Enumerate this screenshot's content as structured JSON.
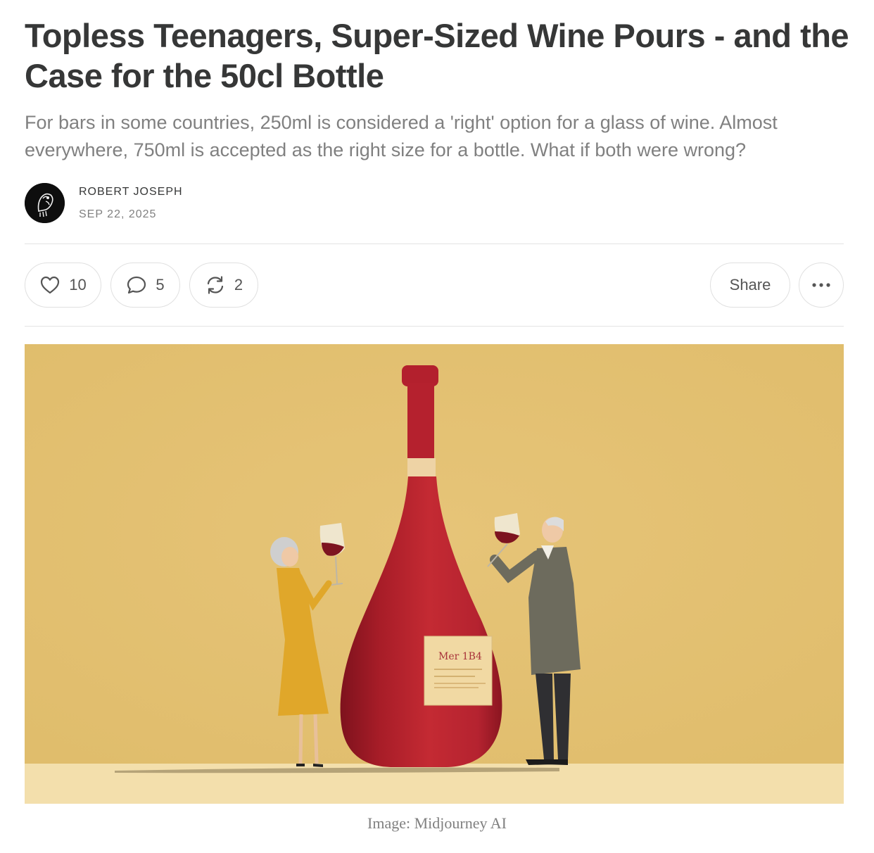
{
  "post": {
    "title": "Topless Teenagers, Super-Sized Wine Pours - and the Case for the 50cl Bottle",
    "subtitle": "For bars in some countries, 250ml is considered a 'right' option for a glass of wine. Almost everywhere, 750ml is accepted as the right size for a bottle. What if both were wrong?",
    "author": "ROBERT JOSEPH",
    "date": "SEP 22, 2025"
  },
  "actions": {
    "like_count": "10",
    "comment_count": "5",
    "restack_count": "2",
    "share_label": "Share"
  },
  "hero": {
    "caption": "Image: Midjourney AI",
    "label_text": "Mer 1B4"
  },
  "icons": {
    "like": "heart-icon",
    "comment": "speech-bubble-icon",
    "restack": "refresh-arrows-icon",
    "more": "ellipsis-icon"
  },
  "colors": {
    "background_yellow": "#e4c273",
    "wine_red": "#b8232e",
    "text_dark": "#363737",
    "text_muted": "#808080"
  }
}
